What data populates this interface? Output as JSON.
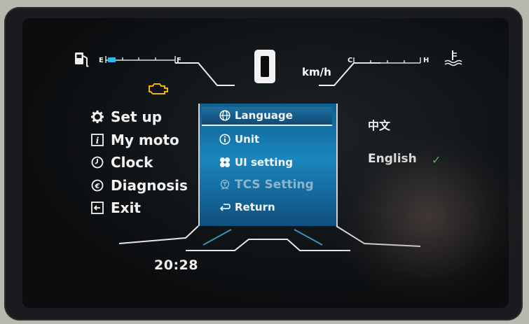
{
  "gauges": {
    "fuel": {
      "empty_label": "E",
      "full_label": "F",
      "icon": "fuel-pump-icon",
      "level": 0.12
    },
    "temperature": {
      "cold_label": "C",
      "hot_label": "H",
      "icon": "coolant-temperature-icon",
      "level": 0.0
    }
  },
  "speed": {
    "value": "0",
    "unit": "km/h"
  },
  "warnings": {
    "engine_icon": "check-engine-icon",
    "engine_color": "#f0b400"
  },
  "menu": {
    "items": [
      {
        "label": "Set up",
        "icon": "gear-icon"
      },
      {
        "label": "My moto",
        "icon": "info-box-icon"
      },
      {
        "label": "Clock",
        "icon": "clock-icon"
      },
      {
        "label": "Diagnosis",
        "icon": "diagnosis-icon"
      },
      {
        "label": "Exit",
        "icon": "exit-icon"
      }
    ]
  },
  "submenu": {
    "items": [
      {
        "label": "Language",
        "icon": "globe-icon",
        "selected": true
      },
      {
        "label": "Unit",
        "icon": "info-circle-icon"
      },
      {
        "label": "UI setting",
        "icon": "fan-icon"
      },
      {
        "label": "TCS Setting",
        "icon": "traction-control-icon"
      },
      {
        "label": "Return",
        "icon": "return-arrow-icon"
      }
    ]
  },
  "language_options": {
    "items": [
      {
        "label": "中文",
        "checked": false
      },
      {
        "label": "English",
        "checked": true
      }
    ],
    "check_mark": "✓"
  },
  "status": {
    "time": "20:28"
  },
  "colors": {
    "accent": "#1a86bd",
    "check": "#59c94a",
    "fuel_fill": "#33b6e6"
  }
}
